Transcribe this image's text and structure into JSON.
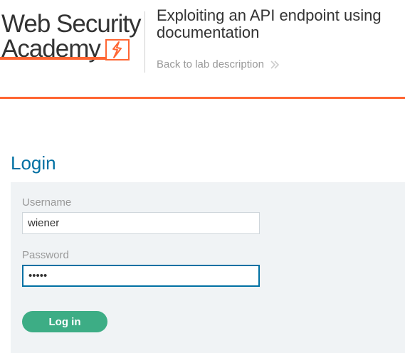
{
  "logo": {
    "line1": "Web Security",
    "line2": "Academy"
  },
  "lab": {
    "title": "Exploiting an API endpoint using documentation",
    "back_link": "Back to lab description"
  },
  "login": {
    "heading": "Login",
    "username_label": "Username",
    "username_value": "wiener",
    "password_label": "Password",
    "password_value": "peter",
    "submit_label": "Log in"
  },
  "colors": {
    "accent": "#ff6633",
    "heading_blue": "#0070a3",
    "button_green": "#3dad85",
    "panel_bg": "#f0f3f5"
  }
}
